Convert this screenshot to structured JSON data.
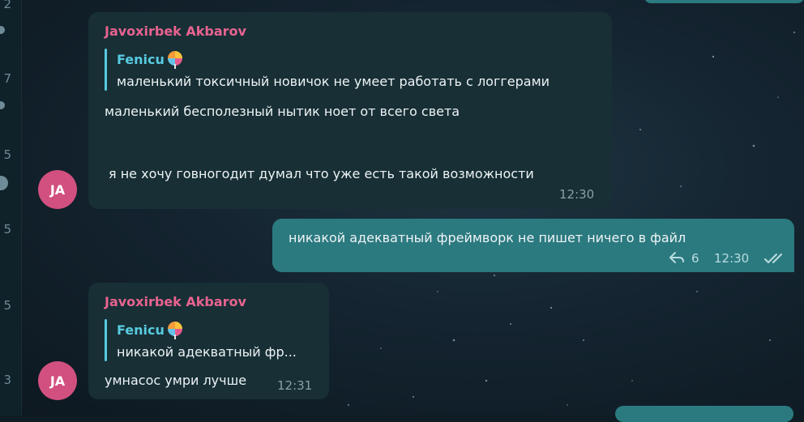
{
  "left_strip": {
    "numbers": [
      "2",
      "7",
      "5",
      "5",
      "5",
      "3"
    ]
  },
  "messages": [
    {
      "sender": "Javoxirbek Akbarov",
      "reply_to_name": "Fenicu",
      "reply_to_text": "маленький токсичный новичок не умеет работать с логгерами",
      "line1": "маленький бесполезный нытик ноет от всего света",
      "line2": "я не хочу говногодит думал что уже есть такой возможности",
      "time": "12:30",
      "avatar_initials": "JA"
    },
    {
      "text": "никакой адекватный фреймворк не пишет ничего в файл",
      "replies_count": "6",
      "time": "12:30"
    },
    {
      "sender": "Javoxirbek Akbarov",
      "reply_to_name": "Fenicu",
      "reply_to_text": "никакой адекватный фр...",
      "text": "умнасос умри лучше",
      "time": "12:31",
      "avatar_initials": "JA"
    }
  ],
  "icons": {
    "reply": "reply-arrow-icon",
    "read": "double-check-icon",
    "emoji": "lollipop-emoji"
  },
  "colors": {
    "incoming_bubble": "#172f35",
    "outgoing_bubble": "#2b7a80",
    "sender_name": "#e86390",
    "reply_accent": "#58cbe0",
    "avatar": "#d1507f"
  }
}
